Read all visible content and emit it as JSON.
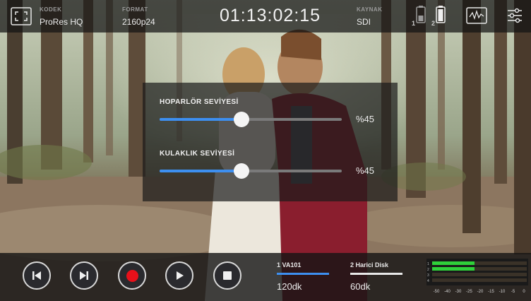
{
  "topbar": {
    "codec_label": "KODEK",
    "codec_value": "ProRes HQ",
    "format_label": "FORMAT",
    "format_value": "2160p24",
    "timecode": "01:13:02:15",
    "source_label": "KAYNAK",
    "source_value": "SDI",
    "battery_1_label": "1",
    "battery_2_label": "2",
    "icons": [
      "fullscreen-icon",
      "battery-icon",
      "waveform-icon",
      "settings-sliders-icon"
    ]
  },
  "panel": {
    "speaker_title": "HOPARLÖR SEVİYESİ",
    "speaker_level": 45,
    "speaker_value": "%45",
    "headphone_title": "KULAKLIK SEVİYESİ",
    "headphone_level": 45,
    "headphone_value": "%45"
  },
  "transport": {
    "icons": [
      "skip-back-icon",
      "skip-forward-icon",
      "record-icon",
      "play-icon",
      "stop-icon"
    ],
    "record_color": "#e8101a"
  },
  "media": {
    "slot1_name": "1  VA101",
    "slot1_time": "120dk",
    "slot1_color": "#3d8ff0",
    "slot2_name": "2 Harici Disk",
    "slot2_time": "60dk",
    "slot2_color": "#e8e8e8"
  },
  "meter": {
    "scale": [
      "-50",
      "-40",
      "-30",
      "-25",
      "-20",
      "-15",
      "-10",
      "-5",
      "0"
    ],
    "channels": [
      "1",
      "2",
      "3",
      "4"
    ]
  },
  "accent_color": "#3d8ff0"
}
